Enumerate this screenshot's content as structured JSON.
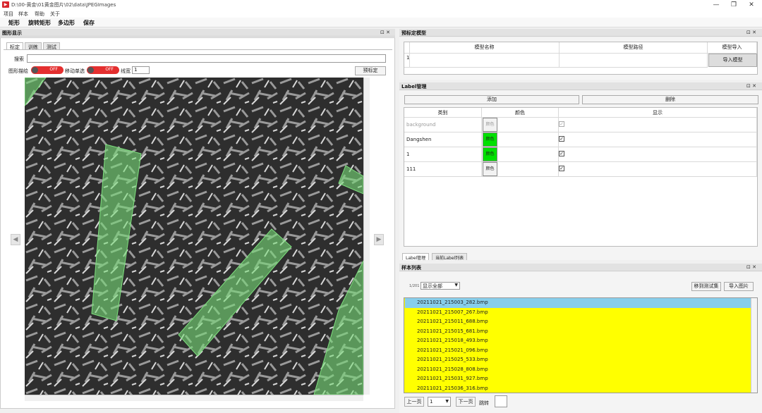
{
  "window": {
    "title": "D:\\00-黄金\\01黄金图片\\02\\data\\JPEGImages",
    "icon_label": "▶",
    "minimize": "—",
    "maximize": "❐",
    "close": "✕"
  },
  "menu": {
    "items": [
      "项目",
      "样本",
      "帮助",
      "关于"
    ]
  },
  "toolbar": {
    "rect": "矩形",
    "rotated_rect": "旋转矩形",
    "polygon": "多边形",
    "save": "保存"
  },
  "left_panel": {
    "title": "图形显示",
    "controls": "⊡ ✕",
    "tabs": [
      "标定",
      "训练",
      "测试"
    ],
    "search_label": "搜索",
    "search_value": "",
    "show_label_text": "图形描绘",
    "toggle_off_text": "OFF",
    "single_select_text": "移动单选",
    "line_width_label": "线宽",
    "line_width_value": "1",
    "pre_label_button": "预标定",
    "prev_arrow": "◀",
    "next_arrow": "▶"
  },
  "model_panel": {
    "title": "预标定模型",
    "controls": "⊡ ✕",
    "col_name": "模型名称",
    "col_path": "模型路径",
    "col_import": "模型导入",
    "row_index": "1",
    "import_button": "导入模型"
  },
  "label_panel": {
    "title": "Label管理",
    "controls": "⊡ ✕",
    "add_button": "添加",
    "delete_button": "删除",
    "col_category": "类别",
    "col_color": "颜色",
    "col_display": "显示",
    "rows": [
      {
        "name": "background",
        "color_label": "颜色",
        "checked": "✓"
      },
      {
        "name": "Dangshen",
        "color_label": "颜色",
        "checked": "✓"
      },
      {
        "name": "1",
        "color_label": "颜色",
        "checked": "✓"
      },
      {
        "name": "111",
        "color_label": "颜色",
        "checked": "✓"
      }
    ],
    "tabs": [
      "Label管理",
      "当前Label列表"
    ]
  },
  "sample_panel": {
    "title": "样本列表",
    "controls": "⊡ ✕",
    "count_text": "1/201",
    "filter_value": "显示全部",
    "move_to_test_button": "移到测试集",
    "import_image_button": "导入图片",
    "files": [
      "20211021_215003_282.bmp",
      "20211021_215007_267.bmp",
      "20211021_215011_688.bmp",
      "20211021_215015_681.bmp",
      "20211021_215018_493.bmp",
      "20211021_215021_096.bmp",
      "20211021_215025_533.bmp",
      "20211021_215028_808.bmp",
      "20211021_215031_927.bmp",
      "20211021_215036_316.bmp"
    ],
    "prev_page": "上一页",
    "page_value": "1",
    "next_page": "下一页",
    "jump_label": "跳转",
    "jump_value": ""
  },
  "colors": {
    "selected_row": "#87ceeb",
    "file_row": "#ffff00",
    "green_label": "#00e000",
    "toggle_red": "#e42f2f"
  }
}
